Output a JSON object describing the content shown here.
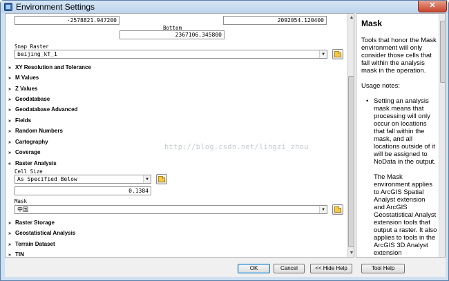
{
  "window": {
    "title": "Environment Settings"
  },
  "extent": {
    "left_value": "-2578821.947200",
    "right_value": "2092054.120400",
    "bottom_label": "Bottom",
    "bottom_value": "2367106.345800"
  },
  "snap_raster": {
    "label": "Snap Raster",
    "value": "beijing_kT_1"
  },
  "sections": {
    "xy_resolution": "XY Resolution and Tolerance",
    "m_values": "M Values",
    "z_values": "Z Values",
    "geodatabase": "Geodatabase",
    "geodatabase_advanced": "Geodatabase Advanced",
    "fields": "Fields",
    "random_numbers": "Random Numbers",
    "cartography": "Cartography",
    "coverage": "Coverage",
    "raster_analysis": "Raster Analysis",
    "raster_storage": "Raster Storage",
    "geostatistical_analysis": "Geostatistical Analysis",
    "terrain_dataset": "Terrain Dataset",
    "tin": "TIN"
  },
  "raster_analysis": {
    "cell_size_label": "Cell Size",
    "cell_size_option": "As Specified Below",
    "cell_size_value": "0.1384",
    "mask_label": "Mask",
    "mask_value": "中国"
  },
  "watermark": "http://blog.csdn.net/lingzi_zhou",
  "help": {
    "title": "Mask",
    "intro": "Tools that honor the Mask environment will only consider those cells that fall within the analysis mask in the operation.",
    "usage_label": "Usage notes:",
    "bullet1": "Setting an analysis mask means that processing will only occur on locations that fall within the mask, and all locations outside of it will be assigned to NoData in the output.",
    "bullet2": "The Mask environment applies to ArcGIS Spatial Analyst extension and ArcGIS Geostatistical Analyst extension tools that output a raster. It also applies to tools in the ArcGIS 3D Analyst extension"
  },
  "buttons": {
    "ok": "OK",
    "cancel": "Cancel",
    "hide_help": "<< Hide Help",
    "tool_help": "Tool Help"
  }
}
